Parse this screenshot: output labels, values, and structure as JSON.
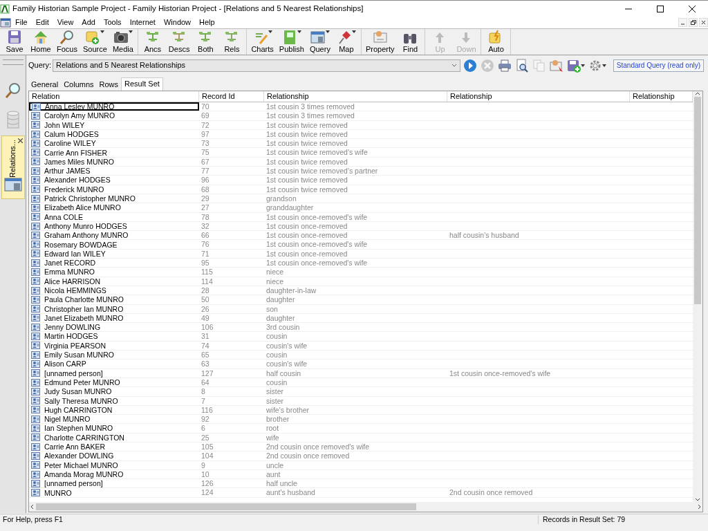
{
  "window": {
    "title": "Family Historian Sample Project - Family Historian Project - [Relations and 5 Nearest Relationships]"
  },
  "menu": [
    "File",
    "Edit",
    "View",
    "Add",
    "Tools",
    "Internet",
    "Window",
    "Help"
  ],
  "toolbar": [
    [
      {
        "label": "Save",
        "dropdown": false,
        "disabled": false
      },
      {
        "label": "Home",
        "dropdown": false,
        "disabled": false
      },
      {
        "label": "Focus",
        "dropdown": false,
        "disabled": false
      },
      {
        "label": "Source",
        "dropdown": true,
        "disabled": false
      },
      {
        "label": "Media",
        "dropdown": true,
        "disabled": false
      }
    ],
    [
      {
        "label": "Ancs",
        "dropdown": false,
        "disabled": false
      },
      {
        "label": "Descs",
        "dropdown": false,
        "disabled": false
      },
      {
        "label": "Both",
        "dropdown": false,
        "disabled": false
      },
      {
        "label": "Rels",
        "dropdown": false,
        "disabled": false
      }
    ],
    [
      {
        "label": "Charts",
        "dropdown": true,
        "disabled": false
      },
      {
        "label": "Publish",
        "dropdown": true,
        "disabled": false
      },
      {
        "label": "Query",
        "dropdown": true,
        "disabled": false
      },
      {
        "label": "Map",
        "dropdown": true,
        "disabled": false
      }
    ],
    [
      {
        "label": "Property",
        "dropdown": false,
        "disabled": false
      },
      {
        "label": "Find",
        "dropdown": false,
        "disabled": false
      }
    ],
    [
      {
        "label": "Up",
        "dropdown": false,
        "disabled": true
      },
      {
        "label": "Down",
        "dropdown": false,
        "disabled": true
      }
    ],
    [
      {
        "label": "Auto",
        "dropdown": false,
        "disabled": false
      }
    ]
  ],
  "sidebar": {
    "tab": {
      "label": "Relations...",
      "selected": true
    }
  },
  "query": {
    "label": "Query:",
    "value": "Relations and 5 Nearest Relationships",
    "status": "Standard Query (read only)"
  },
  "query_tools": [
    {
      "dropdown": false,
      "disabled": false
    },
    {
      "dropdown": false,
      "disabled": true
    },
    {
      "dropdown": false,
      "disabled": false
    },
    {
      "dropdown": false,
      "disabled": false
    },
    {
      "dropdown": false,
      "disabled": true
    },
    {
      "dropdown": false,
      "disabled": false
    },
    {
      "dropdown": true,
      "disabled": false
    },
    {
      "dropdown": true,
      "disabled": false
    }
  ],
  "tabs": [
    {
      "label": "General",
      "selected": false
    },
    {
      "label": "Columns",
      "selected": false
    },
    {
      "label": "Rows",
      "selected": false
    },
    {
      "label": "Result Set",
      "selected": true
    }
  ],
  "table": {
    "columns": [
      "Relation",
      "Record Id",
      "Relationship",
      "Relationship",
      "Relationship"
    ],
    "rows": [
      {
        "cells": [
          "Anna Lesley MUNRO",
          "70",
          "1st cousin 3 times removed"
        ],
        "selected": true
      },
      {
        "cells": [
          "Carolyn Amy MUNRO",
          "69",
          "1st cousin 3 times removed"
        ],
        "selected": false
      },
      {
        "cells": [
          "John WILEY",
          "72",
          "1st cousin twice removed"
        ],
        "selected": false
      },
      {
        "cells": [
          "Calum HODGES",
          "97",
          "1st cousin twice removed"
        ],
        "selected": false
      },
      {
        "cells": [
          "Caroline WILEY",
          "73",
          "1st cousin twice removed"
        ],
        "selected": false
      },
      {
        "cells": [
          "Carrie Ann FISHER",
          "75",
          "1st cousin twice removed's wife"
        ],
        "selected": false
      },
      {
        "cells": [
          "James Miles MUNRO",
          "67",
          "1st cousin twice removed"
        ],
        "selected": false
      },
      {
        "cells": [
          "Arthur JAMES",
          "77",
          "1st cousin twice removed's partner"
        ],
        "selected": false
      },
      {
        "cells": [
          "Alexander HODGES",
          "96",
          "1st cousin twice removed"
        ],
        "selected": false
      },
      {
        "cells": [
          "Frederick MUNRO",
          "68",
          "1st cousin twice removed"
        ],
        "selected": false
      },
      {
        "cells": [
          "Patrick Christopher MUNRO",
          "29",
          "grandson"
        ],
        "selected": false
      },
      {
        "cells": [
          "Elizabeth Alice MUNRO",
          "27",
          "granddaughter"
        ],
        "selected": false
      },
      {
        "cells": [
          "Anna COLE",
          "78",
          "1st cousin once-removed's wife"
        ],
        "selected": false
      },
      {
        "cells": [
          "Anthony Munro HODGES",
          "32",
          "1st cousin once-removed"
        ],
        "selected": false
      },
      {
        "cells": [
          "Graham Anthony MUNRO",
          "66",
          "1st cousin once-removed",
          "half cousin's husband"
        ],
        "selected": false
      },
      {
        "cells": [
          "Rosemary BOWDAGE",
          "76",
          "1st cousin once-removed's wife"
        ],
        "selected": false
      },
      {
        "cells": [
          "Edward Ian WILEY",
          "71",
          "1st cousin once-removed"
        ],
        "selected": false
      },
      {
        "cells": [
          "Janet RECORD",
          "95",
          "1st cousin once-removed's wife"
        ],
        "selected": false
      },
      {
        "cells": [
          "Emma MUNRO",
          "115",
          "niece"
        ],
        "selected": false
      },
      {
        "cells": [
          "Alice HARRISON",
          "114",
          "niece"
        ],
        "selected": false
      },
      {
        "cells": [
          "Nicola HEMMINGS",
          "28",
          "daughter-in-law"
        ],
        "selected": false
      },
      {
        "cells": [
          "Paula Charlotte MUNRO",
          "50",
          "daughter"
        ],
        "selected": false
      },
      {
        "cells": [
          "Christopher Ian MUNRO",
          "26",
          "son"
        ],
        "selected": false
      },
      {
        "cells": [
          "Janet Elizabeth MUNRO",
          "49",
          "daughter"
        ],
        "selected": false
      },
      {
        "cells": [
          "Jenny DOWLING",
          "106",
          "3rd cousin"
        ],
        "selected": false
      },
      {
        "cells": [
          "Martin HODGES",
          "31",
          "cousin"
        ],
        "selected": false
      },
      {
        "cells": [
          "Virginia PEARSON",
          "74",
          "cousin's wife"
        ],
        "selected": false
      },
      {
        "cells": [
          "Emily Susan MUNRO",
          "65",
          "cousin"
        ],
        "selected": false
      },
      {
        "cells": [
          "Alison CARP",
          "63",
          "cousin's wife"
        ],
        "selected": false
      },
      {
        "cells": [
          "[unnamed person]",
          "127",
          "half cousin",
          "1st cousin once-removed's wife"
        ],
        "selected": false
      },
      {
        "cells": [
          "Edmund Peter MUNRO",
          "64",
          "cousin"
        ],
        "selected": false
      },
      {
        "cells": [
          "Judy Susan MUNRO",
          "8",
          "sister"
        ],
        "selected": false
      },
      {
        "cells": [
          "Sally Theresa MUNRO",
          "7",
          "sister"
        ],
        "selected": false
      },
      {
        "cells": [
          "Hugh CARRINGTON",
          "116",
          "wife's brother"
        ],
        "selected": false
      },
      {
        "cells": [
          "Nigel MUNRO",
          "92",
          "brother"
        ],
        "selected": false
      },
      {
        "cells": [
          "Ian Stephen MUNRO",
          "6",
          "root"
        ],
        "selected": false
      },
      {
        "cells": [
          "Charlotte CARRINGTON",
          "25",
          "wife"
        ],
        "selected": false
      },
      {
        "cells": [
          "Carrie Ann BAKER",
          "105",
          "2nd cousin once removed's wife"
        ],
        "selected": false
      },
      {
        "cells": [
          "Alexander DOWLING",
          "104",
          "2nd cousin once removed"
        ],
        "selected": false
      },
      {
        "cells": [
          "Peter Michael MUNRO",
          "9",
          "uncle"
        ],
        "selected": false
      },
      {
        "cells": [
          "Amanda Morag MUNRO",
          "10",
          "aunt"
        ],
        "selected": false
      },
      {
        "cells": [
          "[unnamed person]",
          "126",
          "half uncle"
        ],
        "selected": false
      },
      {
        "cells": [
          "MUNRO",
          "124",
          "aunt's husband",
          "2nd cousin once removed"
        ],
        "selected": false
      }
    ]
  },
  "status_bar": {
    "help": "For Help, press F1",
    "records": "Records in Result Set: 79"
  }
}
